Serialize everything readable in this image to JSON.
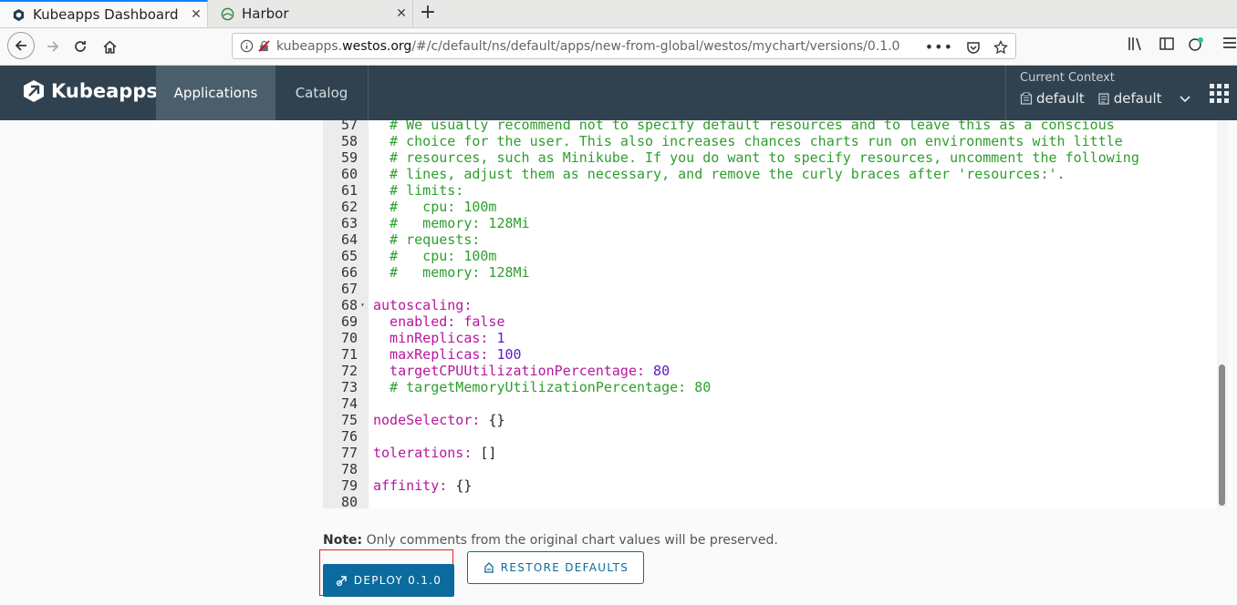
{
  "browser": {
    "tabs": [
      {
        "title": "Kubeapps Dashboard",
        "close": "✕"
      },
      {
        "title": "Harbor",
        "close": "✕"
      }
    ],
    "new_tab": "+",
    "url_prefix": "kubeapps.",
    "url_host": "westos.org",
    "url_path": "/#/c/default/ns/default/apps/new-from-global/westos/mychart/versions/0.1.0"
  },
  "app": {
    "brand": "Kubeapps",
    "nav": {
      "applications": "Applications",
      "catalog": "Catalog"
    },
    "context": {
      "label": "Current Context",
      "cluster": "default",
      "namespace": "default"
    }
  },
  "editor": {
    "lines": [
      {
        "n": "57",
        "code": "  # We usually recommend not to specify default resources and to leave this as a conscious",
        "type": "com"
      },
      {
        "n": "58",
        "code": "  # choice for the user. This also increases chances charts run on environments with little",
        "type": "com"
      },
      {
        "n": "59",
        "code": "  # resources, such as Minikube. If you do want to specify resources, uncomment the following",
        "type": "com"
      },
      {
        "n": "60",
        "code": "  # lines, adjust them as necessary, and remove the curly braces after 'resources:'.",
        "type": "com"
      },
      {
        "n": "61",
        "code": "  # limits:",
        "type": "com"
      },
      {
        "n": "62",
        "code": "  #   cpu: 100m",
        "type": "com"
      },
      {
        "n": "63",
        "code": "  #   memory: 128Mi",
        "type": "com"
      },
      {
        "n": "64",
        "code": "  # requests:",
        "type": "com"
      },
      {
        "n": "65",
        "code": "  #   cpu: 100m",
        "type": "com"
      },
      {
        "n": "66",
        "code": "  #   memory: 128Mi",
        "type": "com"
      },
      {
        "n": "67",
        "code": "",
        "type": "com"
      },
      {
        "n": "68",
        "key": "autoscaling:",
        "val": "",
        "type": "kv",
        "fold": true
      },
      {
        "n": "69",
        "key": "  enabled: ",
        "val": "false",
        "type": "kv",
        "valtype": "bool"
      },
      {
        "n": "70",
        "key": "  minReplicas: ",
        "val": "1",
        "type": "kv",
        "valtype": "num"
      },
      {
        "n": "71",
        "key": "  maxReplicas: ",
        "val": "100",
        "type": "kv",
        "valtype": "num"
      },
      {
        "n": "72",
        "key": "  targetCPUUtilizationPercentage: ",
        "val": "80",
        "type": "kv",
        "valtype": "num"
      },
      {
        "n": "73",
        "code": "  # targetMemoryUtilizationPercentage: 80",
        "type": "com"
      },
      {
        "n": "74",
        "code": "",
        "type": "com"
      },
      {
        "n": "75",
        "key": "nodeSelector: ",
        "val": "{}",
        "type": "kv",
        "valtype": "pun"
      },
      {
        "n": "76",
        "code": "",
        "type": "com"
      },
      {
        "n": "77",
        "key": "tolerations: ",
        "val": "[]",
        "type": "kv",
        "valtype": "pun"
      },
      {
        "n": "78",
        "code": "",
        "type": "com"
      },
      {
        "n": "79",
        "key": "affinity: ",
        "val": "{}",
        "type": "kv",
        "valtype": "pun"
      },
      {
        "n": "80",
        "code": "",
        "type": "com"
      }
    ]
  },
  "footer": {
    "note_label": "Note:",
    "note_text": " Only comments from the original chart values will be preserved.",
    "deploy_label": "DEPLOY 0.1.0",
    "restore_label": "RESTORE DEFAULTS"
  },
  "colors": {
    "header": "#30424f",
    "primary": "#0b6b9e",
    "highlight": "#e0242a"
  }
}
